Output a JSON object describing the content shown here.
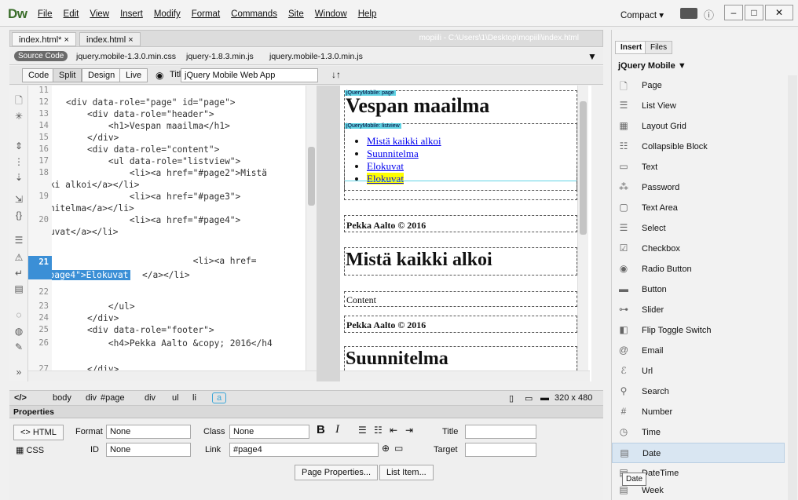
{
  "app": {
    "logo": "Dw",
    "menu": [
      "File",
      "Edit",
      "View",
      "Insert",
      "Modify",
      "Format",
      "Commands",
      "Site",
      "Window",
      "Help"
    ],
    "workspace": "Compact",
    "workspace_caret": "▾",
    "info_icon": "ⓘ"
  },
  "window_controls": [
    "–",
    "□",
    "✕"
  ],
  "doc_tabs": [
    {
      "label": "index.html*",
      "close": "×"
    },
    {
      "label": "index.html",
      "close": "×"
    }
  ],
  "path": "mopiili - C:\\Users\\1\\Desktop\\mopiili\\index.html",
  "related": {
    "source": "Source Code",
    "files": [
      "jquery.mobile-1.3.0.min.css",
      "jquery-1.8.3.min.js",
      "jquery.mobile-1.3.0.min.js"
    ]
  },
  "views": [
    "Code",
    "Split",
    "Design",
    "Live"
  ],
  "title_label": "Title:",
  "title_value": "jQuery Mobile Web App",
  "code": {
    "line_numbers": [
      "11",
      "12",
      "13",
      "14",
      "15",
      "16",
      "17",
      "18",
      "",
      "19",
      "",
      "20",
      "",
      "21",
      "",
      "22",
      "23",
      "24",
      "25",
      "26",
      "",
      "27"
    ],
    "lines": [
      "",
      "<div data-role=\"page\" id=\"page\">",
      "    <div data-role=\"header\">",
      "        <h1>Vespan maailma</h1>",
      "    </div>",
      "    <div data-role=\"content\">",
      "        <ul data-role=\"listview\">",
      "            <li><a href=\"#page2\">Mistä",
      "kaikki alkoi</a></li>",
      "            <li><a href=\"#page3\">",
      "Suunnitelma</a></li>",
      "            <li><a href=\"#page4\">",
      "Elokuvat</a></li>",
      "                        <li><a href=",
      "\"#page4\">Elokuvat</a></li>",
      "",
      "        </ul>",
      "    </div>",
      "    <div data-role=\"footer\">",
      "        <h4>Pekka Aalto &copy; 2016</h4",
      ">",
      "    </div>"
    ],
    "selected_text": "\"#page4\">Elokuvat"
  },
  "design": {
    "label_page": "jQueryMobile: page",
    "header": "Vespan maailma",
    "label_listview": "jQueryMobile: listview",
    "list": [
      "Mistä kaikki alkoi",
      "Suunnitelma",
      "Elokuvat",
      "Elokuvat"
    ],
    "footer1": "Pekka Aalto © 2016",
    "page2_header": "Mistä kaikki alkoi",
    "content": "Content",
    "footer2": "Pekka Aalto © 2016",
    "page3_header": "Suunnitelma"
  },
  "tagbar": {
    "code_icon": "</>",
    "crumbs": [
      "body",
      "div",
      "#page",
      "div",
      "ul",
      "li",
      "a"
    ],
    "viewport": "320 x 480"
  },
  "properties": {
    "title": "Properties",
    "html_btn": "<> HTML",
    "css_btn": "CSS",
    "format_label": "Format",
    "format_value": "None",
    "class_label": "Class",
    "class_value": "None",
    "id_label": "ID",
    "id_value": "None",
    "link_label": "Link",
    "link_value": "#page4",
    "title_label": "Title",
    "target_label": "Target",
    "bold": "B",
    "italic": "I",
    "page_props": "Page Properties...",
    "list_item": "List Item..."
  },
  "insert": {
    "tabs": [
      "Insert",
      "Files"
    ],
    "category": "jQuery Mobile",
    "items": [
      {
        "icon": "page-icon",
        "glyph": "🗋",
        "label": "Page"
      },
      {
        "icon": "list-view-icon",
        "glyph": "☰",
        "label": "List View"
      },
      {
        "icon": "layout-grid-icon",
        "glyph": "▦",
        "label": "Layout Grid"
      },
      {
        "icon": "collapsible-icon",
        "glyph": "☷",
        "label": "Collapsible Block"
      },
      {
        "icon": "text-icon",
        "glyph": "▭",
        "label": "Text"
      },
      {
        "icon": "password-icon",
        "glyph": "⁂",
        "label": "Password"
      },
      {
        "icon": "textarea-icon",
        "glyph": "▢",
        "label": "Text Area"
      },
      {
        "icon": "select-icon",
        "glyph": "☰",
        "label": "Select"
      },
      {
        "icon": "checkbox-icon",
        "glyph": "☑",
        "label": "Checkbox"
      },
      {
        "icon": "radio-icon",
        "glyph": "◉",
        "label": "Radio Button"
      },
      {
        "icon": "button-icon",
        "glyph": "▬",
        "label": "Button"
      },
      {
        "icon": "slider-icon",
        "glyph": "⊶",
        "label": "Slider"
      },
      {
        "icon": "flip-toggle-icon",
        "glyph": "◧",
        "label": "Flip Toggle Switch"
      },
      {
        "icon": "email-icon",
        "glyph": "@",
        "label": "Email"
      },
      {
        "icon": "url-icon",
        "glyph": "ℰ",
        "label": "Url"
      },
      {
        "icon": "search-icon",
        "glyph": "⚲",
        "label": "Search"
      },
      {
        "icon": "number-icon",
        "glyph": "#",
        "label": "Number"
      },
      {
        "icon": "time-icon",
        "glyph": "◷",
        "label": "Time"
      },
      {
        "icon": "date-icon",
        "glyph": "▤",
        "label": "Date"
      },
      {
        "icon": "datetime-icon",
        "glyph": "▤",
        "label": "DateTime"
      },
      {
        "icon": "week-icon",
        "glyph": "▤",
        "label": "Week"
      }
    ],
    "tooltip": "Date"
  }
}
